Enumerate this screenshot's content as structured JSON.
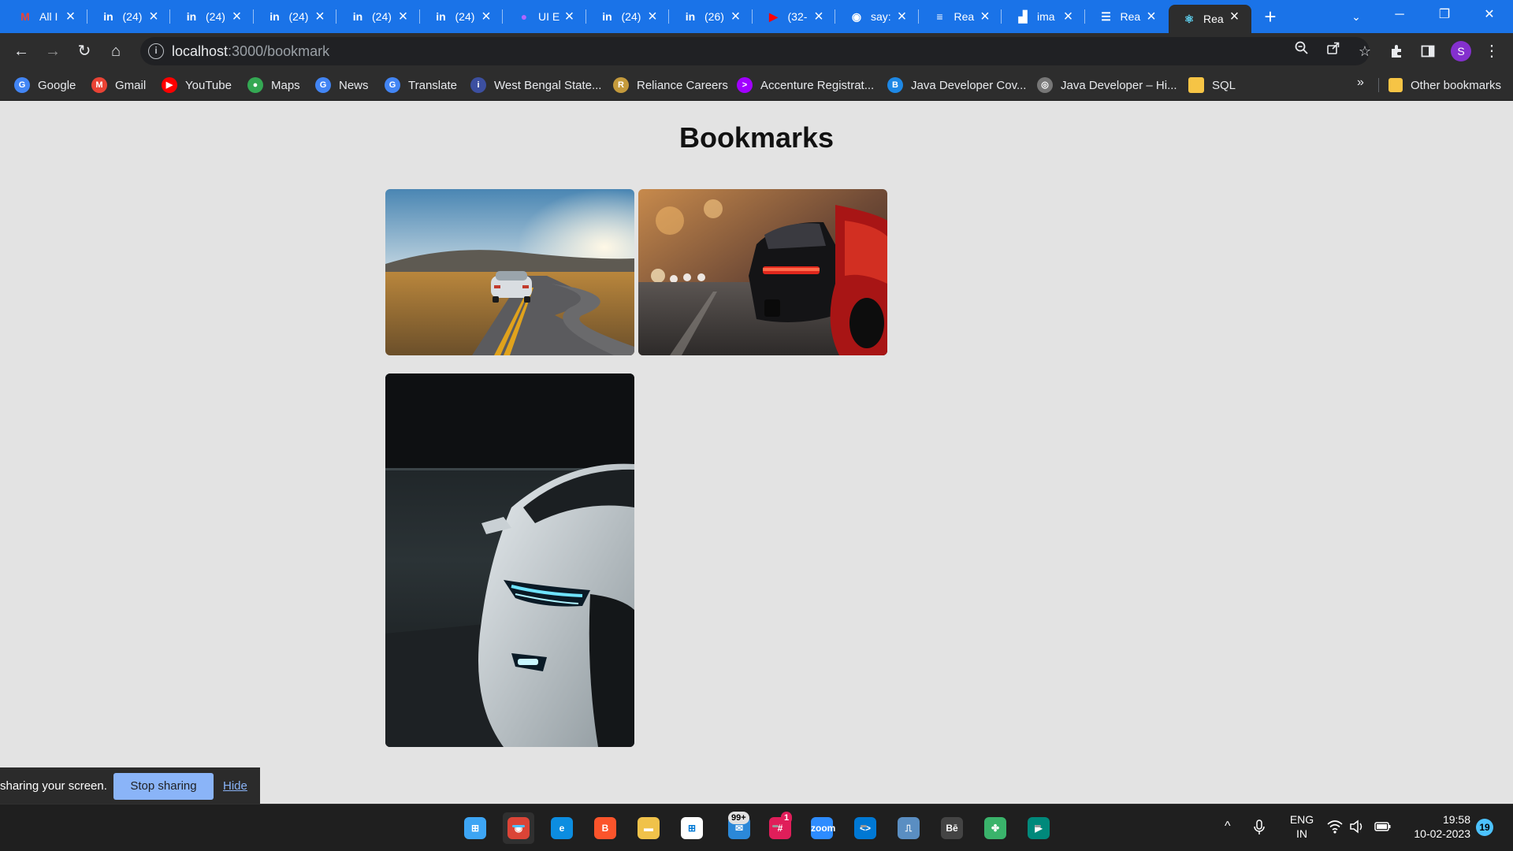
{
  "colors": {
    "tabstrip": "#1a73e8",
    "toolbar": "#2d2d2d",
    "page_bg": "#e3e3e3",
    "stop_sharing_bg": "#8ab4f8",
    "taskbar": "#1f1f1f"
  },
  "browser": {
    "tabs": [
      {
        "title": "All I",
        "icon": "gmail-icon",
        "icon_glyph": "M",
        "icon_color": "#ea4335"
      },
      {
        "title": "(24)",
        "icon": "linkedin-icon",
        "icon_glyph": "in",
        "icon_color": "#ffffff"
      },
      {
        "title": "(24)",
        "icon": "linkedin-icon",
        "icon_glyph": "in",
        "icon_color": "#ffffff"
      },
      {
        "title": "(24)",
        "icon": "linkedin-icon",
        "icon_glyph": "in",
        "icon_color": "#ffffff"
      },
      {
        "title": "(24)",
        "icon": "linkedin-icon",
        "icon_glyph": "in",
        "icon_color": "#ffffff"
      },
      {
        "title": "(24)",
        "icon": "linkedin-icon",
        "icon_glyph": "in",
        "icon_color": "#ffffff"
      },
      {
        "title": "UI E",
        "icon": "globe-icon",
        "icon_glyph": "●",
        "icon_color": "#b066ff"
      },
      {
        "title": "(24)",
        "icon": "linkedin-icon",
        "icon_glyph": "in",
        "icon_color": "#ffffff"
      },
      {
        "title": "(26)",
        "icon": "linkedin-icon",
        "icon_glyph": "in",
        "icon_color": "#ffffff"
      },
      {
        "title": "(32-",
        "icon": "youtube-icon",
        "icon_glyph": "▶",
        "icon_color": "#ff0000"
      },
      {
        "title": "say:",
        "icon": "github-icon",
        "icon_glyph": "◉",
        "icon_color": "#ffffff"
      },
      {
        "title": "Rea",
        "icon": "docs-icon",
        "icon_glyph": "≡",
        "icon_color": "#ffffff"
      },
      {
        "title": "ima",
        "icon": "unsplash-icon",
        "icon_glyph": "▟",
        "icon_color": "#ffffff"
      },
      {
        "title": "Rea",
        "icon": "list-icon",
        "icon_glyph": "☰",
        "icon_color": "#ffffff"
      },
      {
        "title": "Rea",
        "icon": "react-icon",
        "icon_glyph": "⚛",
        "icon_color": "#61dafb",
        "active": true
      }
    ],
    "new_tab": "+",
    "tab_search": "⌄",
    "window_controls": {
      "minimize": "─",
      "restore": "❐",
      "close": "✕"
    },
    "toolbar": {
      "back": "←",
      "forward": "→",
      "reload": "↻",
      "home": "⌂"
    },
    "address": {
      "host": "localhost",
      "path": ":3000/bookmark",
      "info": "i"
    },
    "omnibox_icons": {
      "zoom": "zoom-icon",
      "share": "share-icon",
      "star": "☆"
    },
    "extensions": "puzzle-icon",
    "side_panel": "side-panel-icon",
    "profile_initial": "S",
    "menu": "⋮",
    "bookmarks": [
      {
        "label": "Google",
        "icon": "google-icon",
        "glyph": "G",
        "color": "#4285f4"
      },
      {
        "label": "Gmail",
        "icon": "gmail-icon",
        "glyph": "M",
        "color": "#ea4335"
      },
      {
        "label": "YouTube",
        "icon": "youtube-icon",
        "glyph": "▶",
        "color": "#ff0000"
      },
      {
        "label": "Maps",
        "icon": "maps-icon",
        "glyph": "●",
        "color": "#34a853"
      },
      {
        "label": "News",
        "icon": "news-icon",
        "glyph": "G",
        "color": "#4285f4"
      },
      {
        "label": "Translate",
        "icon": "translate-icon",
        "glyph": "G",
        "color": "#4285f4"
      },
      {
        "label": "West Bengal State...",
        "icon": "globe-icon",
        "glyph": "i",
        "color": "#3c4fa0"
      },
      {
        "label": "Reliance Careers",
        "icon": "reliance-icon",
        "glyph": "R",
        "color": "#c49a3c"
      },
      {
        "label": "Accenture Registrat...",
        "icon": "accenture-icon",
        "glyph": ">",
        "color": "#a100ff"
      },
      {
        "label": "Java Developer Cov...",
        "icon": "bing-icon",
        "glyph": "B",
        "color": "#1e88e5"
      },
      {
        "label": "Java Developer – Hi...",
        "icon": "globe-icon",
        "glyph": "◎",
        "color": "#777777"
      },
      {
        "label": "SQL",
        "icon": "folder-icon",
        "glyph": "",
        "color": "#f6c445"
      }
    ],
    "bookmarks_more": "»",
    "other_bookmarks": {
      "label": "Other bookmarks",
      "icon": "folder-icon",
      "color": "#f6c445"
    }
  },
  "page": {
    "title": "Bookmarks",
    "cards": [
      {
        "name": "bookmark-image-white-car-road",
        "description": "white sports car on winding road"
      },
      {
        "name": "bookmark-image-red-car-street",
        "description": "red car tail lights on city street"
      },
      {
        "name": "bookmark-image-silver-car-headlight",
        "description": "silver car headlight in dark garage"
      }
    ]
  },
  "share_bar": {
    "text": "sharing your screen.",
    "stop_label": "Stop sharing",
    "hide_label": "Hide"
  },
  "taskbar": {
    "apps": [
      {
        "name": "windows-start-icon",
        "glyph": "⊞",
        "color": "#3da5f4"
      },
      {
        "name": "chrome-icon",
        "glyph": "◉",
        "color": "#db4437",
        "active": true
      },
      {
        "name": "edge-icon",
        "glyph": "e",
        "color": "#0c8de0"
      },
      {
        "name": "brave-icon",
        "glyph": "B",
        "color": "#fb542b"
      },
      {
        "name": "file-explorer-icon",
        "glyph": "▬",
        "color": "#f0c24a"
      },
      {
        "name": "microsoft-store-icon",
        "glyph": "⊞",
        "color": "#ffffff"
      },
      {
        "name": "mail-icon",
        "glyph": "✉",
        "color": "#2b88d8"
      },
      {
        "name": "slack-icon",
        "glyph": "#",
        "color": "#e01e5a"
      },
      {
        "name": "zoom-icon",
        "glyph": "zoom",
        "color": "#2d8cff"
      },
      {
        "name": "vscode-icon",
        "glyph": "<>",
        "color": "#0078d4"
      },
      {
        "name": "task-manager-icon",
        "glyph": "⎍",
        "color": "#5a8ec2"
      },
      {
        "name": "behance-icon",
        "glyph": "Bē",
        "color": "#444444"
      },
      {
        "name": "pinwheel-icon",
        "glyph": "✤",
        "color": "#3ab36b"
      },
      {
        "name": "google-meet-icon",
        "glyph": "▶",
        "color": "#00897b"
      }
    ],
    "mail_badge": "99+",
    "slack_badge": "1",
    "tray": {
      "chevron": "^",
      "mic": "🎙",
      "language_line1": "ENG",
      "language_line2": "IN",
      "wifi": "wifi-icon",
      "volume": "volume-icon",
      "battery": "battery-icon",
      "time": "19:58",
      "date": "10-02-2023",
      "notifications": "19"
    }
  }
}
